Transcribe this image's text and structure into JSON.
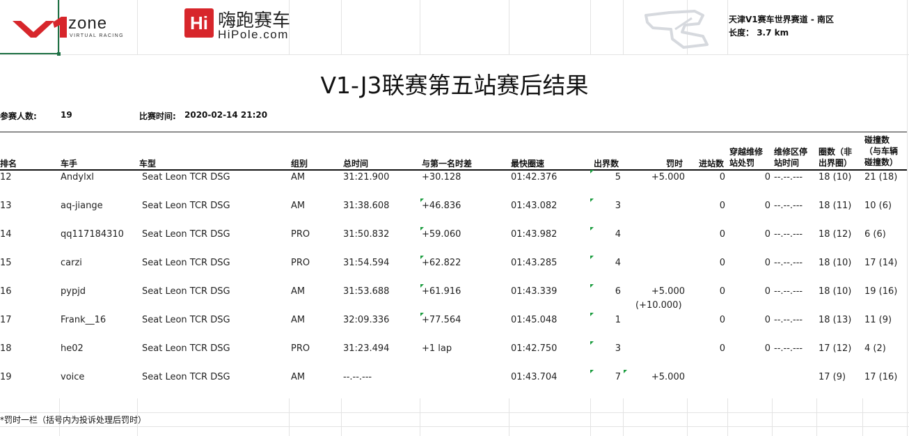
{
  "brand": {
    "v1_logo_text": "zone",
    "v1_logo_sub": "VIRTUAL RACING",
    "hipole_icon": "Hi",
    "hipole_cn": "嗨跑赛车",
    "hipole_en": "HiPole.com",
    "accent_red": "#d7262b"
  },
  "track": {
    "name": "天津V1赛车世界赛道 - 南区",
    "length_label": "长度：",
    "length_value": "3.7 km",
    "icon": "track-map-icon"
  },
  "title": "V1-J3联赛第五站赛后结果",
  "meta": {
    "participants_label": "参赛人数:",
    "participants_value": "19",
    "time_label": "比赛时间:",
    "time_value": "2020-02-14 21:20"
  },
  "headers": {
    "rank": "排名",
    "driver": "车手",
    "car": "车型",
    "group": "组别",
    "total_time": "总时间",
    "gap": "与第一名时差",
    "best_lap": "最快圈速",
    "off_track": "出界数",
    "penalty": "罚时",
    "pit_stops": "进站数",
    "pit_penalty_1": "穿越维修",
    "pit_penalty_2": "站处罚",
    "pit_time_1": "维修区停",
    "pit_time_2": "站时间",
    "laps_1": "圈数（非",
    "laps_2": "出界圈）",
    "collisions_1": "碰撞数",
    "collisions_2": "（与车辆",
    "collisions_3": "碰撞数）"
  },
  "rows": [
    {
      "rank": "12",
      "driver": "Andylxl",
      "car": "Seat Leon TCR DSG",
      "group": "AM",
      "total": "31:21.900",
      "gap": "+30.128",
      "best": "01:42.376",
      "off": "5",
      "penalty": "+5.000",
      "penalty2": "",
      "pits": "0",
      "pit_pen": "0",
      "pit_time": "--.--.---",
      "laps": "18 (10)",
      "coll": "21 (18)"
    },
    {
      "rank": "13",
      "driver": "aq-jiange",
      "car": "Seat Leon TCR DSG",
      "group": "AM",
      "total": "31:38.608",
      "gap": "+46.836",
      "best": "01:43.082",
      "off": "3",
      "penalty": "",
      "penalty2": "",
      "pits": "0",
      "pit_pen": "0",
      "pit_time": "--.--.---",
      "laps": "18 (11)",
      "coll": "10 (6)"
    },
    {
      "rank": "14",
      "driver": "qq117184310",
      "car": "Seat Leon TCR DSG",
      "group": "PRO",
      "total": "31:50.832",
      "gap": "+59.060",
      "best": "01:43.982",
      "off": "4",
      "penalty": "",
      "penalty2": "",
      "pits": "0",
      "pit_pen": "0",
      "pit_time": "--.--.---",
      "laps": "18 (12)",
      "coll": "6 (6)"
    },
    {
      "rank": "15",
      "driver": "carzi",
      "car": "Seat Leon TCR DSG",
      "group": "PRO",
      "total": "31:54.594",
      "gap": "+62.822",
      "best": "01:43.285",
      "off": "4",
      "penalty": "",
      "penalty2": "",
      "pits": "0",
      "pit_pen": "0",
      "pit_time": "--.--.---",
      "laps": "18 (10)",
      "coll": "17 (14)"
    },
    {
      "rank": "16",
      "driver": "pypjd",
      "car": "Seat Leon TCR DSG",
      "group": "AM",
      "total": "31:53.688",
      "gap": "+61.916",
      "best": "01:43.339",
      "off": "6",
      "penalty": "+5.000",
      "penalty2": "(+10.000)",
      "pits": "0",
      "pit_pen": "0",
      "pit_time": "--.--.---",
      "laps": "18 (10)",
      "coll": "19 (16)"
    },
    {
      "rank": "17",
      "driver": "Frank__16",
      "car": "Seat Leon TCR DSG",
      "group": "AM",
      "total": "32:09.336",
      "gap": "+77.564",
      "best": "01:45.048",
      "off": "1",
      "penalty": "",
      "penalty2": "",
      "pits": "0",
      "pit_pen": "0",
      "pit_time": "--.--.---",
      "laps": "18 (13)",
      "coll": "11 (9)"
    },
    {
      "rank": "18",
      "driver": "he02",
      "car": "Seat Leon TCR DSG",
      "group": "PRO",
      "total": "31:23.494",
      "gap": "+1 lap",
      "best": "01:42.750",
      "off": "3",
      "penalty": "",
      "penalty2": "",
      "pits": "0",
      "pit_pen": "0",
      "pit_time": "--.--.---",
      "laps": "17 (12)",
      "coll": "4 (2)"
    },
    {
      "rank": "19",
      "driver": "voice",
      "car": "Seat Leon TCR DSG",
      "group": "AM",
      "total": "--.--.---",
      "gap": "",
      "best": "01:43.704",
      "off": "7",
      "penalty": "+5.000",
      "penalty2": "",
      "pits": "",
      "pit_pen": "",
      "pit_time": "",
      "laps": "17 (9)",
      "coll": "17 (16)"
    }
  ],
  "footnote": "*罚时一栏（括号内为投诉处理后罚时）"
}
